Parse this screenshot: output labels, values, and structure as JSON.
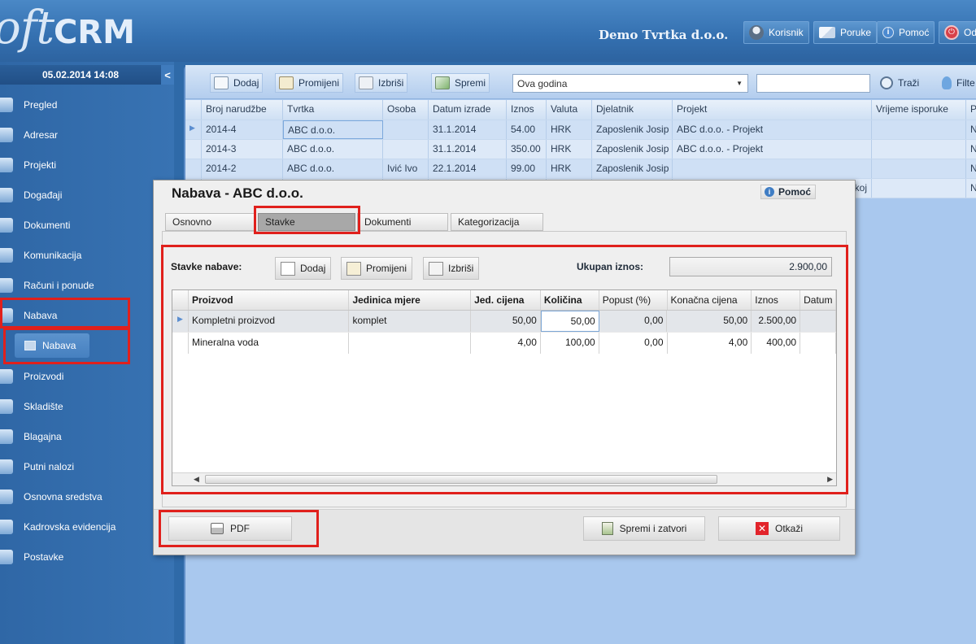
{
  "header": {
    "logo_left": "oft",
    "logo_right": "CRM",
    "company": "Demo Tvrtka d.o.o.",
    "buttons": [
      {
        "label": "Korisnik",
        "icon": "user-icon"
      },
      {
        "label": "Poruke",
        "icon": "envelope-icon"
      },
      {
        "label": "Pomoć",
        "icon": "info-icon"
      },
      {
        "label": "Od",
        "icon": "power-icon"
      }
    ]
  },
  "sidebar": {
    "datetime": "05.02.2014 14:08",
    "collapse": "<",
    "items": [
      {
        "label": "Pregled"
      },
      {
        "label": "Adresar"
      },
      {
        "label": "Projekti"
      },
      {
        "label": "Događaji"
      },
      {
        "label": "Dokumenti"
      },
      {
        "label": "Komunikacija"
      },
      {
        "label": "Računi i ponude"
      },
      {
        "label": "Nabava"
      },
      {
        "label": "Proizvodi"
      },
      {
        "label": "Skladište"
      },
      {
        "label": "Blagajna"
      },
      {
        "label": "Putni nalozi"
      },
      {
        "label": "Osnovna sredstva"
      },
      {
        "label": "Kadrovska evidencija"
      },
      {
        "label": "Postavke"
      }
    ],
    "subitem": "Nabava"
  },
  "toolbar": {
    "add": "Dodaj",
    "edit": "Promijeni",
    "delete": "Izbriši",
    "save": "Spremi",
    "period": "Ova godina",
    "search_value": "",
    "search": "Traži",
    "filter": "Filte"
  },
  "main_grid": {
    "headers": [
      "Broj narudžbe",
      "Tvrtka",
      "Osoba",
      "Datum izrade",
      "Iznos",
      "Valuta",
      "Djelatnik",
      "Projekt",
      "Vrijeme isporuke",
      "P"
    ],
    "rows": [
      [
        "2014-4",
        "ABC d.o.o.",
        "",
        "31.1.2014",
        "54.00",
        "HRK",
        "Zaposlenik Josip",
        "ABC d.o.o. - Projekt",
        "",
        "N"
      ],
      [
        "2014-3",
        "ABC d.o.o.",
        "",
        "31.1.2014",
        "350.00",
        "HRK",
        "Zaposlenik Josip",
        "ABC d.o.o. - Projekt",
        "",
        "N"
      ],
      [
        "2014-2",
        "ABC d.o.o.",
        "Ivić Ivo",
        "22.1.2014",
        "99.00",
        "HRK",
        "Zaposlenik Josip",
        "",
        "",
        "N"
      ],
      [
        "",
        "",
        "",
        "",
        "",
        "",
        "",
        "koj",
        "",
        "N"
      ]
    ]
  },
  "dialog": {
    "title": "Nabava - ABC d.o.o.",
    "help": "Pomoć",
    "tabs": [
      "Osnovno",
      "Stavke",
      "Dokumenti",
      "Kategorizacija"
    ],
    "items_label": "Stavke nabave:",
    "add": "Dodaj",
    "edit": "Promijeni",
    "delete": "Izbriši",
    "total_label": "Ukupan iznos:",
    "total_value": "2.900,00",
    "grid": {
      "headers": [
        "Proizvod",
        "Jedinica mjere",
        "Jed. cijena",
        "Količina",
        "Popust (%)",
        "Konačna cijena",
        "Iznos",
        "Datum"
      ],
      "rows": [
        [
          "Kompletni proizvod",
          "komplet",
          "50,00",
          "50,00",
          "0,00",
          "50,00",
          "2.500,00",
          ""
        ],
        [
          "Mineralna voda",
          "",
          "4,00",
          "100,00",
          "0,00",
          "4,00",
          "400,00",
          ""
        ]
      ]
    },
    "pdf": "PDF",
    "save_close": "Spremi i zatvori",
    "cancel": "Otkaži"
  }
}
